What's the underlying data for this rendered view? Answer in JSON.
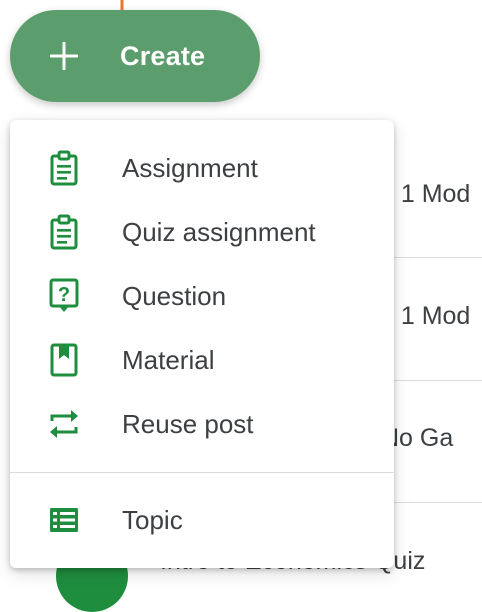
{
  "create_button": {
    "label": "Create",
    "icon": "plus-icon"
  },
  "create_menu": {
    "items": [
      {
        "label": "Assignment",
        "icon": "assignment-icon"
      },
      {
        "label": "Quiz assignment",
        "icon": "quiz-assignment-icon"
      },
      {
        "label": "Question",
        "icon": "question-icon"
      },
      {
        "label": "Material",
        "icon": "material-icon"
      },
      {
        "label": "Reuse post",
        "icon": "reuse-post-icon"
      }
    ],
    "topic": {
      "label": "Topic",
      "icon": "topic-icon"
    }
  },
  "stream": {
    "rows": [
      {
        "text": "e 1 Mod"
      },
      {
        "text": "e 1 Mod"
      },
      {
        "text": "No Ga"
      },
      {
        "text": "Intro to Economics Quiz"
      }
    ]
  },
  "colors": {
    "accent_green": "#1e8e3e",
    "create_button_bg": "#5b9d6c",
    "annotation_orange": "#e8762c"
  }
}
